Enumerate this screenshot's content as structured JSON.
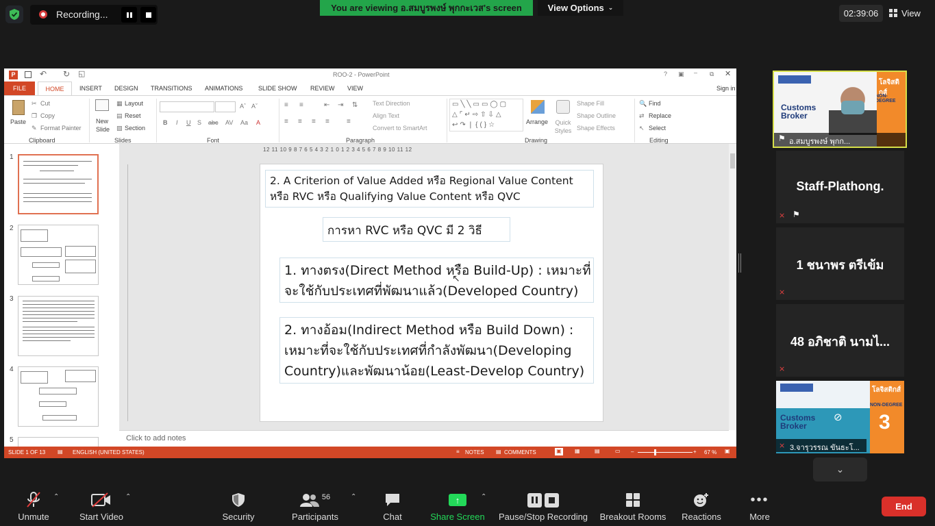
{
  "top": {
    "recording_label": "Recording...",
    "viewing_banner": "You are viewing อ.สมบูรพงษ์  พุกกะเวส's screen",
    "view_options": "View Options",
    "clock": "02:39:06",
    "view_label": "View"
  },
  "ppt": {
    "title": "ROO-2 - PowerPoint",
    "sign_in": "Sign in",
    "tabs": [
      "FILE",
      "HOME",
      "INSERT",
      "DESIGN",
      "TRANSITIONS",
      "ANIMATIONS",
      "SLIDE SHOW",
      "REVIEW",
      "VIEW"
    ],
    "ribbon": {
      "paste": "Paste",
      "cut": "Cut",
      "copy": "Copy",
      "format_painter": "Format Painter",
      "new_slide": "New Slide",
      "layout": "Layout",
      "reset": "Reset",
      "section": "Section",
      "text_direction": "Text Direction",
      "align_text": "Align Text",
      "convert_smartart": "Convert to SmartArt",
      "arrange": "Arrange",
      "quick_styles": "Quick Styles",
      "shape_fill": "Shape Fill",
      "shape_outline": "Shape Outline",
      "shape_effects": "Shape Effects",
      "find": "Find",
      "replace": "Replace",
      "select": "Select",
      "groups": [
        "Clipboard",
        "Slides",
        "Font",
        "Paragraph",
        "Drawing",
        "Editing"
      ]
    },
    "ruler": "12 11 10 9 8 7 6 5 4 3 2 1 0 1 2 3 4 5 6 7 8 9 10 11 12",
    "thumb_numbers": [
      "1",
      "2",
      "3",
      "4",
      "5"
    ],
    "slide": {
      "box1": "2. A Criterion of Value Added หรือ Regional Value Content หรือ RVC หรือ Qualifying Value Content หรือ QVC",
      "box2": "การหา RVC หรือ QVC มี 2 วิธี",
      "box3_a": "1. ทางตรง(Direct Method หรือ Build-Up) : เหมาะที่",
      "box3_b": "จะใช้กับประเทศที่พัฒนาแล้ว(Developed Country)",
      "box4_a": "2. ทางอ้อม(Indirect Method หรือ Build Down) :",
      "box4_b": "เหมาะที่จะใช้กับประเทศที่กำลังพัฒนา(Developing",
      "box4_c": "Country)และพัฒนาน้อย(Least-Develop Country)"
    },
    "notes_placeholder": "Click to add notes",
    "status": {
      "slide_of": "SLIDE 1 OF 13",
      "language": "ENGLISH (UNITED STATES)",
      "notes": "NOTES",
      "comments": "COMMENTS",
      "zoom": "67 %"
    }
  },
  "participants_panel": [
    {
      "name": "อ.สมบูรพงษ์  พุกก...",
      "banner": "Customs Broker",
      "logo": "โลจิสติกส์",
      "sub": "NON-DEGREE"
    },
    {
      "name": "Staff-Plathong."
    },
    {
      "name": "1 ชนาพร ตรีเข้ม"
    },
    {
      "name": "48 อภิชาติ นามไ..."
    },
    {
      "name": "3.จารุวรรณ ขันธะโ...",
      "banner": "Customs Broker",
      "logo": "โลจิสติกส์",
      "sub": "NON-DEGREE",
      "badge": "3"
    }
  ],
  "toolbar": {
    "unmute": "Unmute",
    "start_video": "Start Video",
    "security": "Security",
    "participants": "Participants",
    "participants_count": "56",
    "chat": "Chat",
    "share_screen": "Share Screen",
    "pause_recording": "Pause/Stop Recording",
    "breakout": "Breakout Rooms",
    "reactions": "Reactions",
    "more": "More",
    "end": "End"
  },
  "colors": {
    "zoom_green": "#23a54a",
    "ppt_orange": "#d24726",
    "end_red": "#d9302a",
    "share_green": "#23d959"
  }
}
